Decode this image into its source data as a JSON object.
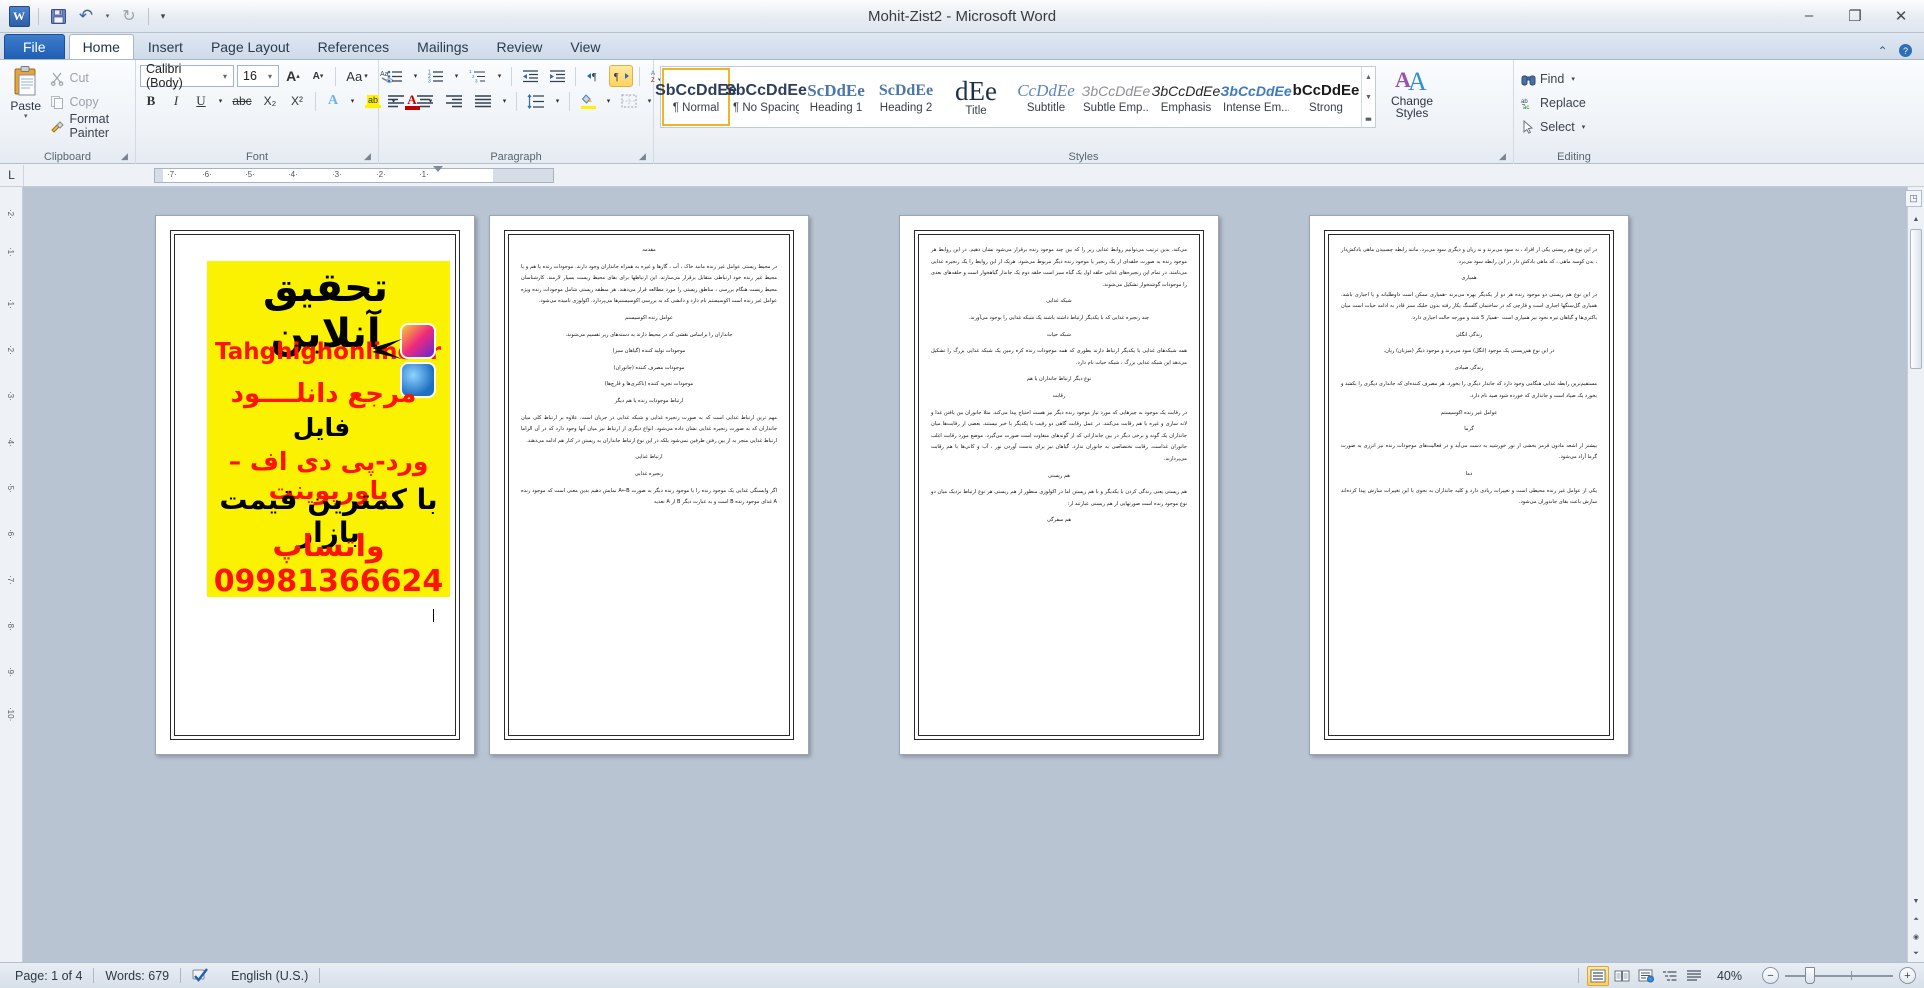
{
  "window": {
    "title": "Mohit-Zist2  -  Microsoft Word",
    "minimize": "–",
    "maximize": "❐",
    "close": "✕"
  },
  "quick_access": {
    "app_logo": "W",
    "save": "save-icon",
    "undo": "↶",
    "undo_dropdown": "▾",
    "redo": "↻",
    "customize": "▾"
  },
  "tabs": [
    {
      "label": "File",
      "kind": "file"
    },
    {
      "label": "Home",
      "kind": "active"
    },
    {
      "label": "Insert",
      "kind": "normal"
    },
    {
      "label": "Page Layout",
      "kind": "normal"
    },
    {
      "label": "References",
      "kind": "normal"
    },
    {
      "label": "Mailings",
      "kind": "normal"
    },
    {
      "label": "Review",
      "kind": "normal"
    },
    {
      "label": "View",
      "kind": "normal"
    }
  ],
  "window_help": {
    "minimize_ribbon": "⌃",
    "help": "?"
  },
  "ribbon": {
    "clipboard": {
      "label": "Clipboard",
      "paste": "Paste",
      "paste_arrow": "▾",
      "cut": "Cut",
      "copy": "Copy",
      "format_painter": "Format Painter"
    },
    "font": {
      "label": "Font",
      "font_name": "Calibri (Body)",
      "font_size": "16",
      "grow_font": "A",
      "shrink_font": "A",
      "change_case": "Aa",
      "clear_formatting": "clear-formatting-icon",
      "bold": "B",
      "italic": "I",
      "underline": "U",
      "strikethrough": "abc",
      "subscript": "X₂",
      "superscript": "X²",
      "text_effects": "A",
      "highlight": "ab",
      "font_color": "A"
    },
    "paragraph": {
      "label": "Paragraph",
      "bullets": "bullets-icon",
      "numbering": "numbering-icon",
      "multilevel": "multilevel-list-icon",
      "decrease_indent": "decrease-indent-icon",
      "increase_indent": "increase-indent-icon",
      "ltr": "ltr-icon",
      "rtl": "rtl-icon",
      "sort": "sort-icon",
      "show_marks": "¶",
      "align_left": "align-left-icon",
      "align_center": "align-center-icon",
      "align_right": "align-right-icon",
      "justify": "justify-icon",
      "line_spacing": "line-spacing-icon",
      "shading": "shading-icon",
      "borders": "borders-icon"
    },
    "styles": {
      "label": "Styles",
      "items": [
        {
          "preview": "ЅbCcDdEe",
          "name": "¶ Normal",
          "selected": true
        },
        {
          "preview": "ЅbCcDdEe",
          "name": "¶ No Spacing",
          "selected": false
        },
        {
          "preview": "ЅcDdEe",
          "name": "Heading 1",
          "selected": false
        },
        {
          "preview": "ЅcDdEe",
          "name": "Heading 2",
          "selected": false
        },
        {
          "preview": "dEe",
          "name": "Title",
          "selected": false
        },
        {
          "preview": "CcDdEe",
          "name": "Subtitle",
          "selected": false
        },
        {
          "preview": "ЗbCcDdEe",
          "name": "Subtle Emp...",
          "selected": false
        },
        {
          "preview": "ЗbCcDdEe",
          "name": "Emphasis",
          "selected": false
        },
        {
          "preview": "ЗbCcDdEe",
          "name": "Intense Em...",
          "selected": false
        },
        {
          "preview": "bCcDdEe",
          "name": "Strong",
          "selected": false
        }
      ],
      "scroll_up": "▲",
      "scroll_down": "▼",
      "more": "▃",
      "change_styles": "Change\nStyles",
      "change_styles_l1": "Change",
      "change_styles_l2": "Styles",
      "change_styles_arrow": "▾"
    },
    "editing": {
      "label": "Editing",
      "find": "Find",
      "find_arrow": "▾",
      "replace": "Replace",
      "select": "Select",
      "select_arrow": "▾"
    }
  },
  "ruler": {
    "tab_selector": "L",
    "marks": [
      "7",
      "6",
      "5",
      "4",
      "3",
      "2",
      "1"
    ],
    "vertical_marks": [
      "2",
      "1",
      "1",
      "2",
      "3",
      "4",
      "5",
      "6",
      "7",
      "8",
      "9",
      "10"
    ]
  },
  "document": {
    "pages": [
      {
        "page_number": 1,
        "ad": {
          "headline": "تحقیق آنلاین",
          "url": "Tahghighonline.ir",
          "instagram_icon": "instagram-icon",
          "web_icon": "web-icon",
          "line1": "مرجع دانلــــود",
          "line2": "فایل",
          "line3": "ورد-پی دی اف – پاورپوینت",
          "line4": "با کمترین قیمت بازار",
          "line5": "واتساپ 09981366624"
        },
        "paragraphs": []
      },
      {
        "page_number": 2,
        "paragraphs": [
          {
            "text": "مقدمه",
            "align": "center"
          },
          {
            "text": "در محیط زیستی عوامل غیر زنده مانند خاک ، آب ، گازها و غیره به همراه جانداران وجود دارند. موجودات زنده یا هم و یا محیط غیر زنده خود ارتباطی متقابل برقرار می‌سازند. این ارتباطها برای بقای محیط زیست بسیار لازمند. کارشناسان محیط زیست هنگام بررسی ، مناطق زیستی را مورد مطالعه قرار می‌دهند. هر منطقه زیستی شامل موجودات زنده ویژه عوامل غیر زنده است اکوسیستم نام دارد و دانشی که به بررسی اکوسیستم‌ها می‌پردازد. اکولوژی نامیده می‌شود.",
            "align": "justify"
          },
          {
            "text": "عوامل زنده اکوسیستم",
            "align": "center"
          },
          {
            "text": "جانداران را براساس نقشی که در محیط دارند به دسته‌های زیر تقسیم می‌شوند.",
            "align": "center"
          },
          {
            "text": "موجودات تولید کننده (گیاهان سبز)",
            "align": "center"
          },
          {
            "text": "موجودات مصرف کننده (جانوران)",
            "align": "center"
          },
          {
            "text": "موجودات تجزیه کننده (باکتری‌ها و قارچ‌ها)",
            "align": "center"
          },
          {
            "text": "ارتباط موجودات زنده یا هم دیگر",
            "align": "center"
          },
          {
            "text": "مهم ترین ارتباط غذایی است که به صورت زنجیره غذایی و شبکه غذایی در جریان است. علاوه بر ارتباط کلی میان جانداران که به صورت زنجیره غذایی نشان داده می‌شود. انواع دیگری از ارتباط نیز میان آنها وجود دارد که در آن الزاما ارتباط غذایی منجر به از بین رفتن طرفین نمی‌شود بلکه در این نوع ارتباط جانداران به زیستن در کنار هم ادامه می‌دهند.",
            "align": "justify"
          },
          {
            "text": "ارتباط غذایی",
            "align": "center"
          },
          {
            "text": "زنجیره غذایی",
            "align": "center"
          },
          {
            "text": "اگر وابستگی غذایی یک موجود زنده را یا موجود زنده دیگر به صورت A←B نمایش دهیم بدین معنی است که موجود زنده A غذای موجود زنده B است و به عبارت دیگر B از A تغذیه",
            "align": "justify"
          }
        ]
      },
      {
        "page_number": 3,
        "paragraphs": [
          {
            "text": "می‌کند. بدین ترتیب می‌توانیم روابط غذایی زیر را که بین چند موجود زنده برقرار می‌شود نشان دهیم. در این روابط هر موجود زنده به صورت حلقه‌ای از یک زنجیر یا موجود زنده دیگر مربوط می‌شود. هریک از این روابط را یک زنجیره غذایی می‌نامند. در تمام این زنجیره‌های غذایی حلقه اول یک گیاه سبز است حلقه دوم یک جاندار گیاهخوار است و حلقه‌های بعدی را موجودات گوشتخوار تشکیل می‌شوند.",
            "align": "justify"
          },
          {
            "text": "شبکه غذایی",
            "align": "center"
          },
          {
            "text": "چند زنجیره غذایی که با یکدیگر ارتباط داشته باشند یک شبکه غذایی را بوجود می‌آورند.",
            "align": "center"
          },
          {
            "text": "شبکه حیات",
            "align": "center"
          },
          {
            "text": "همه شبکه‌های غذایی با یکدیگر ارتباط دارند بطوری که همه موجودات زنده کره زمین یک شبکه غذایی بزرگ را تشکیل می‌دهد این شبکه غذایی بزرگ ، شبکه حیات نام دارد.",
            "align": "justify"
          },
          {
            "text": "نوع دیگر ارتباط جانداران یا هم",
            "align": "center"
          },
          {
            "text": "رقابت",
            "align": "center"
          },
          {
            "text": "در رقابت یک موجود به چیزهایی که مورد نیاز موجود زنده دیگر نیز هست احتیاج پیدا می‌کند. مثلا جانوران بین یافتن غذا و لانه سازی و غیره با هم رقابت می‌کنند. در عمل رقابت گاهی دو رقیب با یکدیگر با خبر نیستند. بعضی از رقابت‌ها میان جانداران یک گونه و برخی دیگر در بین جاندارانی که از گونه‌های متفاوت است صورت می‌گیرد. موضع مورد رقابت اغلب جانوران غذاست. رقابت تختصاصی به جانوران ندارد. گیاهان نیز برای بدست آوردن نور ، آب و کانی‌ها با هم رقابت می‌پردازند.",
            "align": "justify"
          },
          {
            "text": "هم زیستی",
            "align": "center"
          },
          {
            "text": "هم زیستی یعنی زندگی کردن با یکدیگر و با هم زیستن اما در اکولوژی منظور از هم زیستی هر نوع ارتباط نزدیک میان دو نوع موجود زنده است صورتهایی از هم زیستی عبارتند از:",
            "align": "justify"
          },
          {
            "text": "هم سفرگی",
            "align": "center"
          }
        ]
      },
      {
        "page_number": 4,
        "paragraphs": [
          {
            "text": "در این نوع هم زیستی یکی از افراد ، نه سود می‌برند و نه زیان و دیگری سود می‌برد. مانند رابطه چسبیدن ماهی بادکش‌دار ، بدن کوسه ماهی ، که ماهی بادکش دار در این رابطه سود می‌برد.",
            "align": "justify"
          },
          {
            "text": "همیاری",
            "align": "center"
          },
          {
            "text": "در این نوع هم زیستی دو موجود زنده هر دو از یکدیگر بهره می‌برند -همیاری ممکن است داوطلبانه و یا اجباری باشد. همیاری گل‌سنگها اجباری است و قارچی که در ساختمان گلسنگ یکار رفته بدون جلبک سبز قادر به ادامه حیات است میان باکتری‌ها و گیاهان تیره نخود نیز همیاری است  -همیار 5 شته و مورجه حالت اجباری دارد.",
            "align": "justify"
          },
          {
            "text": "زندگی انگلی",
            "align": "center"
          },
          {
            "text": "در این نوع هم‌زیستی یک موجود (انگل) سود می‌برند و موجود دیگر (میزبان) زیان.",
            "align": "center"
          },
          {
            "text": "زندگی صیادی",
            "align": "center"
          },
          {
            "text": "مستقیم‌ترین رابطه غذایی هنگامی وجود دارد که جاندار دیگری را بخورد. هر مصرف کننده‌ای که جانداری دیگری را بکشد و بخورد یک صیاد است و جانداری که خورده شود صید نام دارد.",
            "align": "justify"
          },
          {
            "text": "عوامل غیر زنده اکوسیستم",
            "align": "center"
          },
          {
            "text": "گرما",
            "align": "center"
          },
          {
            "text": "بیشتر از اشعه مادون قرمز بخشی از نور خورشید به دست می‌آید و در فعالیت‌های موجودات زنده نیز انرژی به صورت گرما آزاد می‌شود.",
            "align": "justify"
          },
          {
            "text": "دما",
            "align": "center"
          },
          {
            "text": "یکی از عوامل غیر زنده محیطی است و تغییرات زیادی دارد و کلیه جانداران به نحوی با این تغییرات سازش پیدا کرده‌اند سازش باعث بقای جاندوران می‌شود.",
            "align": "justify"
          }
        ]
      }
    ]
  },
  "status_bar": {
    "page": "Page: 1 of 4",
    "words": "Words: 679",
    "proof_icon": "spelling-check-icon",
    "language": "English (U.S.)",
    "views": [
      {
        "name": "print-layout",
        "glyph": "≡",
        "active": true
      },
      {
        "name": "full-screen-reading",
        "glyph": "◫",
        "active": false
      },
      {
        "name": "web-layout",
        "glyph": "⧉",
        "active": false
      },
      {
        "name": "outline",
        "glyph": "≣",
        "active": false
      },
      {
        "name": "draft",
        "glyph": "☰",
        "active": false
      }
    ],
    "zoom": "40%",
    "zoom_out": "−",
    "zoom_in": "+"
  }
}
